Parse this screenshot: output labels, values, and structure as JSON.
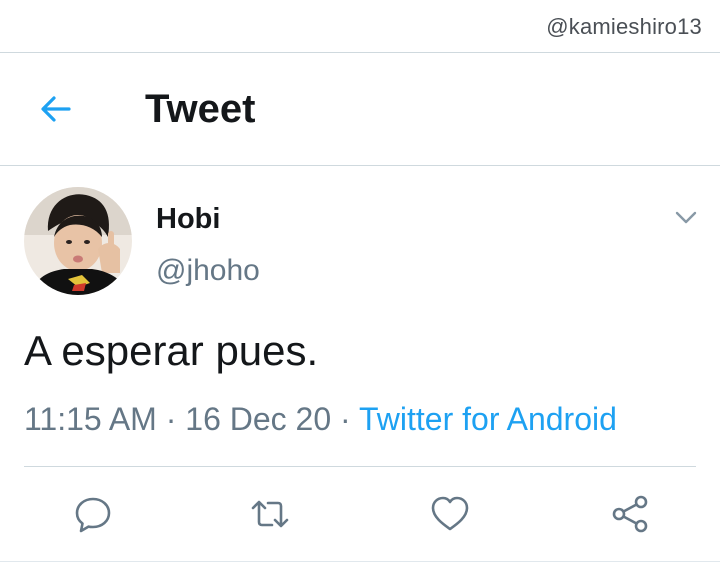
{
  "watermark": "@kamieshiro13",
  "header": {
    "title": "Tweet",
    "back_icon": "arrow-left-icon"
  },
  "tweet": {
    "author": {
      "display_name": "Hobi",
      "username": "@jhoho"
    },
    "text": "A esperar pues.",
    "time": "11:15 AM",
    "separator": "·",
    "date": "16 Dec 20",
    "source": "Twitter for Android"
  },
  "actions": [
    {
      "icon": "reply-icon"
    },
    {
      "icon": "retweet-icon"
    },
    {
      "icon": "like-icon"
    },
    {
      "icon": "share-icon"
    }
  ],
  "colors": {
    "accent": "#1da1f2",
    "text_primary": "#14171a",
    "text_secondary": "#657786",
    "divider": "#cfd9de"
  }
}
